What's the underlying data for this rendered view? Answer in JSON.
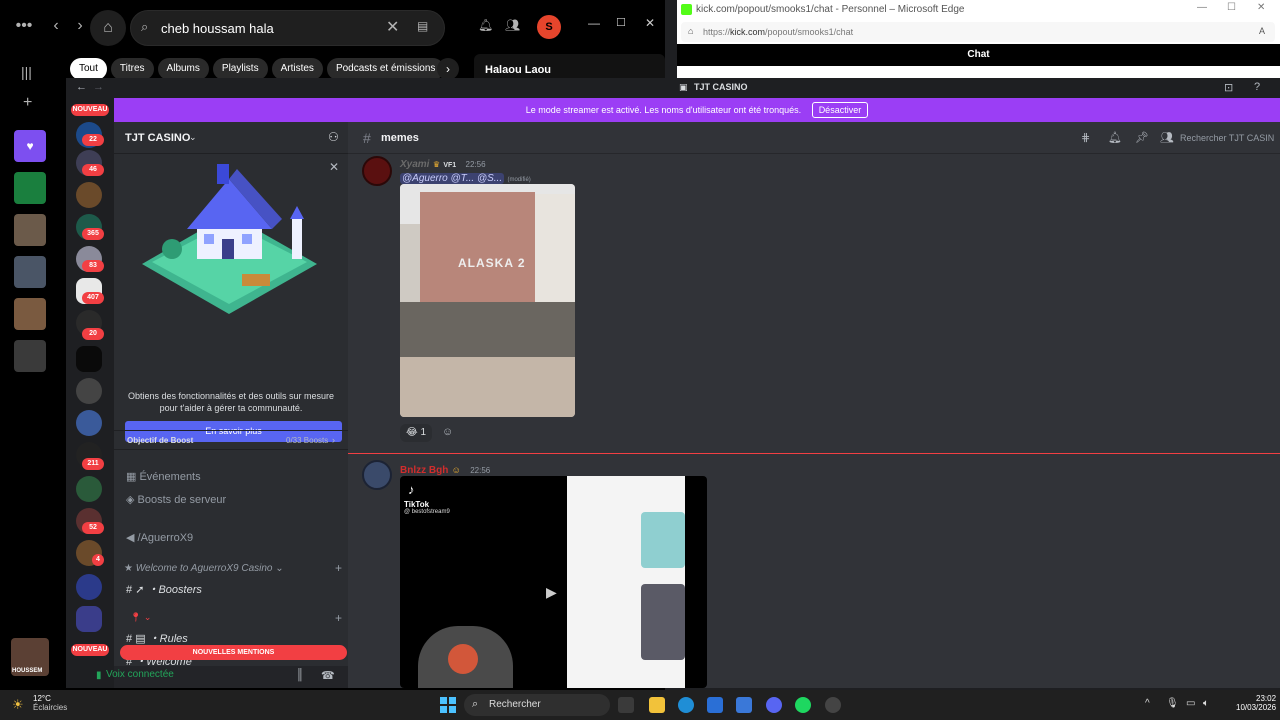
{
  "spotify": {
    "search_value": "cheb houssam hala",
    "chips": [
      "Tout",
      "Titres",
      "Albums",
      "Playlists",
      "Artistes",
      "Podcasts et émissions"
    ],
    "side_panel_title": "Halaou Laou",
    "avatar_letter": "S",
    "user_label": "HOUSSEM"
  },
  "edge": {
    "window_title": "kick.com/popout/smooks1/chat - Personnel – Microsoft Edge",
    "url_prefix": "https://",
    "url_domain": "kick.com",
    "url_path": "/popout/smooks1/chat",
    "page_header": "Chat"
  },
  "discord": {
    "window_title": "TJT CASINO",
    "banner_text": "Le mode streamer est activé. Les noms d'utilisateur ont été tronqués.",
    "banner_button": "Désactiver",
    "server_badges": {
      "nouveau_top": "NOUVEAU",
      "b1": "22",
      "b2": "46",
      "b3": "365",
      "b4": "83",
      "b5": "407",
      "b6": "20",
      "b7": "211",
      "b8": "52",
      "b9": "4",
      "nouveau_bottom": "NOUVEAU"
    },
    "guild_name": "TJT CASINO",
    "promo_text": "Obtiens des fonctionnalités et des outils sur mesure pour t'aider à gérer ta communauté.",
    "promo_button": "En savoir plus",
    "boost_label": "Objectif de Boost",
    "boost_count": "0/33 Boosts",
    "channels": {
      "events": "Événements",
      "boosts": "Boosts de serveur",
      "aguerro": "/AguerroX9",
      "category_welcome": "Welcome to AguerroX9 Casino",
      "boosters": "・Boosters",
      "rules": "・Rules",
      "welcome": "・Welcome"
    },
    "mentions_banner": "NOUVELLES MENTIONS",
    "voice_status": "Voix connectée",
    "current_channel": "memes",
    "search_placeholder": "Rechercher TJT CASIN",
    "messages": [
      {
        "author": "Xyami",
        "tag": "VF1",
        "time": "22:56",
        "mentions": "@Aguerro @T... @S...",
        "edited": "(modifié)",
        "image_text": "ALASKA 2",
        "reaction_count": "1"
      },
      {
        "author": "Bnlzz Bgh",
        "time": "22:56",
        "video_brand": "TikTok",
        "video_handle": "@ bestofstream9"
      }
    ]
  },
  "taskbar": {
    "weather_temp": "12°C",
    "weather_desc": "Éclaircies",
    "search_label": "Rechercher",
    "time": "23:02",
    "date": "10/03/2026"
  },
  "colors": {
    "discord_blurple": "#5865f2",
    "streamer_banner": "#9b3ef5",
    "badge_red": "#f23f43",
    "kick_green": "#53fc18",
    "spotify_avatar": "#e6452c"
  }
}
